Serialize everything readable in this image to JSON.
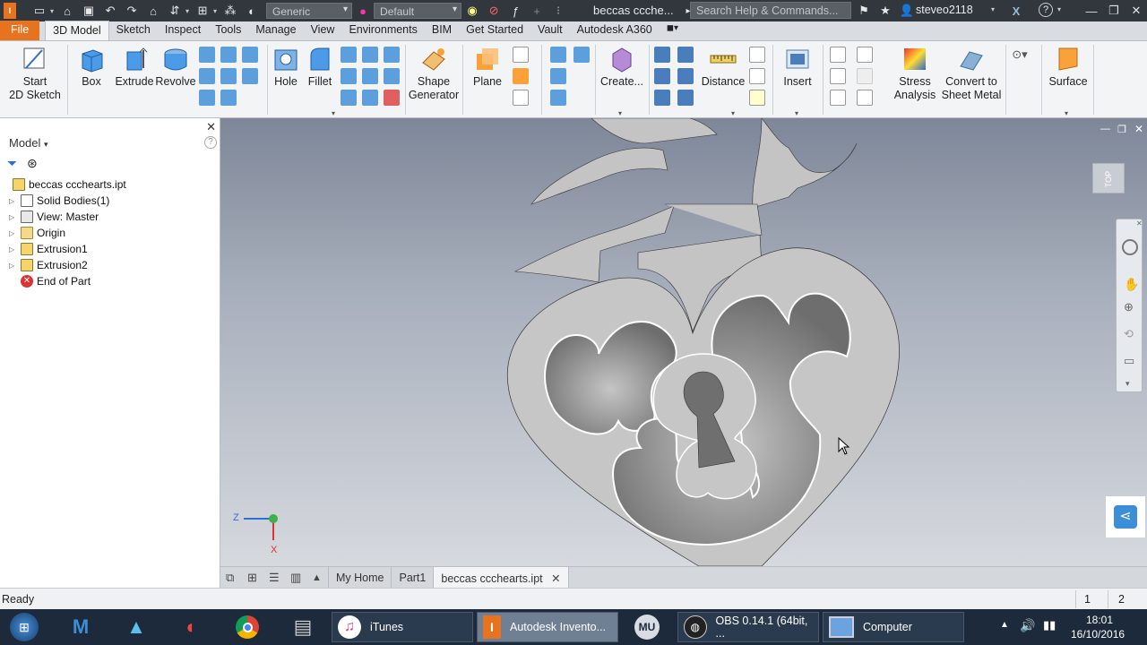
{
  "titlebar": {
    "appearance": "Generic",
    "material": "Default",
    "doc_title": "beccas ccche...",
    "search_placeholder": "Search Help & Commands...",
    "user": "steveo2118"
  },
  "tabs": [
    "File",
    "3D Model",
    "Sketch",
    "Inspect",
    "Tools",
    "Manage",
    "View",
    "Environments",
    "BIM",
    "Get Started",
    "Vault",
    "Autodesk A360"
  ],
  "active_tab": "3D Model",
  "ribbon": {
    "start_sketch": "Start\n2D Sketch",
    "box": "Box",
    "extrude": "Extrude",
    "revolve": "Revolve",
    "hole": "Hole",
    "fillet": "Fillet",
    "shape_generator": "Shape\nGenerator",
    "plane": "Plane",
    "create": "Create...",
    "distance": "Distance",
    "insert": "Insert",
    "stress_analysis": "Stress\nAnalysis",
    "convert_sheet_metal": "Convert to\nSheet Metal",
    "surface": "Surface"
  },
  "browser": {
    "title": "Model",
    "tree": [
      {
        "label": "beccas cccheart s.ipt",
        "level": 0
      },
      {
        "label": "Solid Bodies(1)",
        "level": 1
      },
      {
        "label": "View: Master",
        "level": 1
      },
      {
        "label": "Origin",
        "level": 1
      },
      {
        "label": "Extrusion1",
        "level": 1
      },
      {
        "label": "Extrusion2",
        "level": 1
      },
      {
        "label": "End of Part",
        "level": 1
      }
    ]
  },
  "viewcube_label": "TOP",
  "axis": {
    "z": "Z",
    "x": "X"
  },
  "doc_tabs": [
    "My Home",
    "Part1",
    "beccas ccchearts.ipt"
  ],
  "status": {
    "text": "Ready",
    "num1": "1",
    "num2": "2"
  },
  "taskbar": {
    "itunes": "iTunes",
    "inventor": "Autodesk Invento...",
    "obs": "OBS 0.14.1 (64bit, ...",
    "computer": "Computer",
    "time": "18:01",
    "date": "16/10/2016"
  }
}
